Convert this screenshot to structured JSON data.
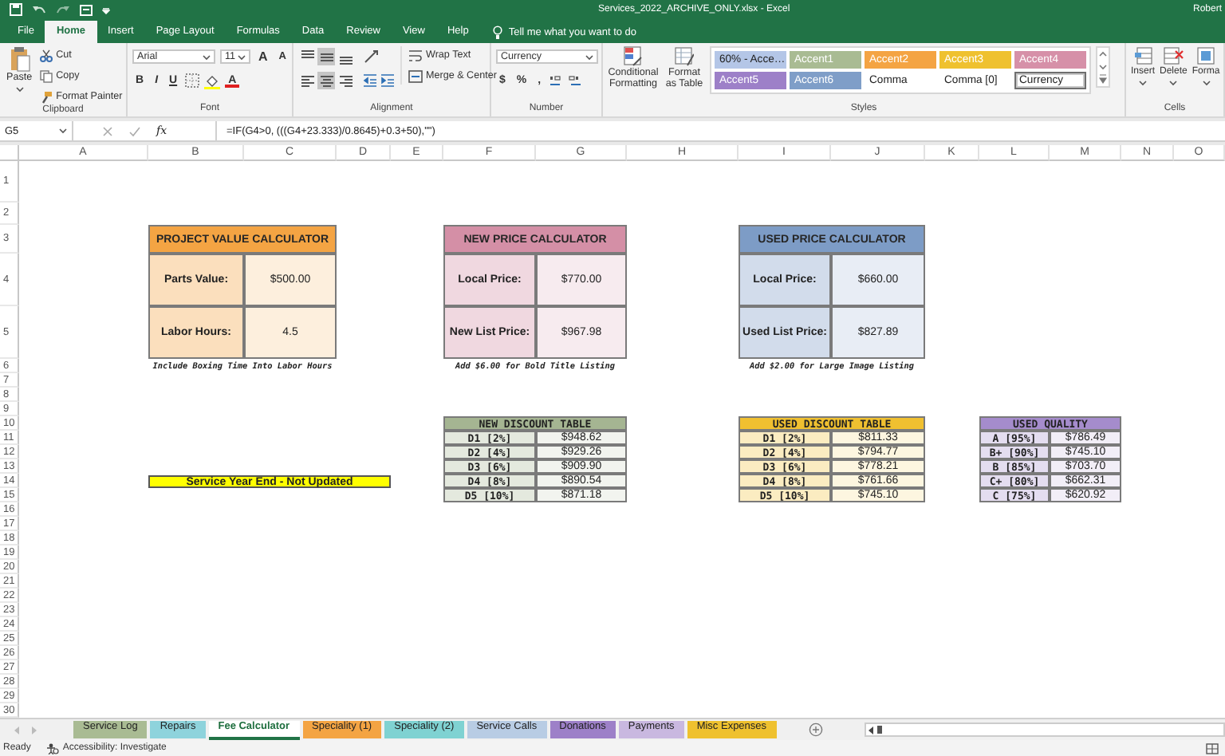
{
  "title_bar": {
    "title": "Services_2022_ARCHIVE_ONLY.xlsx - Excel",
    "user": "Robert"
  },
  "ribbon_tabs": [
    {
      "label": "File",
      "selected": false
    },
    {
      "label": "Home",
      "selected": true
    },
    {
      "label": "Insert",
      "selected": false
    },
    {
      "label": "Page Layout",
      "selected": false
    },
    {
      "label": "Formulas",
      "selected": false
    },
    {
      "label": "Data",
      "selected": false
    },
    {
      "label": "Review",
      "selected": false
    },
    {
      "label": "View",
      "selected": false
    },
    {
      "label": "Help",
      "selected": false
    }
  ],
  "tell_me": "Tell me what you want to do",
  "clipboard": {
    "paste": "Paste",
    "cut": "Cut",
    "copy": "Copy",
    "format_painter": "Format Painter",
    "label": "Clipboard"
  },
  "font": {
    "name": "Arial",
    "size": "11",
    "grow": "A",
    "shrink": "A",
    "bold": "B",
    "italic": "I",
    "underline": "U",
    "font_color": "A",
    "label": "Font"
  },
  "alignment": {
    "buttons": [
      {
        "selected": false
      },
      {
        "selected": true
      },
      {
        "selected": false
      },
      {
        "selected": false
      },
      {
        "selected": true
      },
      {
        "selected": false
      }
    ],
    "wrap_text": "Wrap Text",
    "merge_center": "Merge & Center",
    "label": "Alignment"
  },
  "number": {
    "format": "Currency",
    "currency": "$",
    "percent": "%",
    "comma": ",",
    "label": "Number"
  },
  "styles": {
    "conditional_formatting": "Conditional Formatting",
    "format_as_table": "Format as Table",
    "label": "Styles",
    "items": [
      {
        "label": "60% - Acce…",
        "kind": "tint",
        "color": "#b4c6e7",
        "selected": false
      },
      {
        "label": "Accent1",
        "kind": "accent",
        "color": "#a9bb93",
        "selected": false
      },
      {
        "label": "Accent2",
        "kind": "accent",
        "color": "#f4a443",
        "selected": false
      },
      {
        "label": "Accent3",
        "kind": "accent",
        "color": "#efc12f",
        "selected": false
      },
      {
        "label": "Accent4",
        "kind": "accent",
        "color": "#d690a8",
        "selected": false
      },
      {
        "label": "Accent5",
        "kind": "accent",
        "color": "#9d80c8",
        "selected": false
      },
      {
        "label": "Accent6",
        "kind": "accent",
        "color": "#7f9ec8",
        "selected": false
      },
      {
        "label": "Comma",
        "kind": "plain",
        "color": "#ffffff",
        "selected": false
      },
      {
        "label": "Comma [0]",
        "kind": "plain",
        "color": "#ffffff",
        "selected": false
      },
      {
        "label": "Currency",
        "kind": "plain",
        "color": "#ffffff",
        "selected": true
      }
    ]
  },
  "cells": {
    "insert": "Insert",
    "delete": "Delete",
    "format": "Forma",
    "label": "Cells"
  },
  "formula_bar": {
    "name_box": "G5",
    "function_label": "fx",
    "formula": "=IF(G4>0, (((G4+23.333)/0.8645)+0.3+50),\"\")"
  },
  "columns": [
    "A",
    "B",
    "C",
    "D",
    "E",
    "F",
    "G",
    "H",
    "I",
    "J",
    "K",
    "L",
    "M",
    "N",
    "O"
  ],
  "rows": [
    "1",
    "2",
    "3",
    "4",
    "5",
    "6",
    "7",
    "8",
    "9",
    "10",
    "11",
    "12",
    "13",
    "14",
    "15",
    "16",
    "17",
    "18",
    "19",
    "20",
    "21",
    "22",
    "23",
    "24",
    "25",
    "26",
    "27",
    "28",
    "29",
    "30"
  ],
  "calculators": [
    {
      "title": "PROJECT VALUE CALCULATOR",
      "color": "#f4a443",
      "rows": [
        {
          "label": "Parts Value:",
          "value": "$500.00"
        },
        {
          "label": "Labor Hours:",
          "value": "4.5"
        }
      ],
      "note": "Include Boxing Time Into Labor Hours"
    },
    {
      "title": "NEW PRICE CALCULATOR",
      "color": "#d48fa6",
      "rows": [
        {
          "label": "Local Price:",
          "value": "$770.00"
        },
        {
          "label": "New List Price:",
          "value": "$967.98"
        }
      ],
      "note": "Add $6.00 for Bold Title Listing"
    },
    {
      "title": "USED PRICE CALCULATOR",
      "color": "#7d9cc6",
      "rows": [
        {
          "label": "Local Price:",
          "value": "$660.00"
        },
        {
          "label": "Used List Price:",
          "value": "$827.89"
        }
      ],
      "note": "Add $2.00 for Large Image Listing"
    }
  ],
  "banner": {
    "text": "Service Year End - Not Updated"
  },
  "discount_tables": [
    {
      "title": "NEW DISCOUNT TABLE",
      "color": "#a5b592",
      "rows": [
        {
          "label": "D1 [2%]",
          "value": "$948.62"
        },
        {
          "label": "D2 [4%]",
          "value": "$929.26"
        },
        {
          "label": "D3 [6%]",
          "value": "$909.90"
        },
        {
          "label": "D4 [8%]",
          "value": "$890.54"
        },
        {
          "label": "D5 [10%]",
          "value": "$871.18"
        }
      ]
    },
    {
      "title": "USED DISCOUNT TABLE",
      "color": "#f0c030",
      "rows": [
        {
          "label": "D1 [2%]",
          "value": "$811.33"
        },
        {
          "label": "D2 [4%]",
          "value": "$794.77"
        },
        {
          "label": "D3 [6%]",
          "value": "$778.21"
        },
        {
          "label": "D4 [8%]",
          "value": "$761.66"
        },
        {
          "label": "D5 [10%]",
          "value": "$745.10"
        }
      ]
    },
    {
      "title": "USED QUALITY",
      "color": "#a58ccc",
      "rows": [
        {
          "label": "A [95%]",
          "value": "$786.49"
        },
        {
          "label": "B+ [90%]",
          "value": "$745.10"
        },
        {
          "label": "B [85%]",
          "value": "$703.70"
        },
        {
          "label": "C+ [80%]",
          "value": "$662.31"
        },
        {
          "label": "C [75%]",
          "value": "$620.92"
        }
      ]
    }
  ],
  "sheet_tabs": [
    {
      "label": "Service Log",
      "color": "#a9bb93",
      "selected": false
    },
    {
      "label": "Repairs",
      "color": "#8ed3dc",
      "selected": false
    },
    {
      "label": "Fee Calculator",
      "selected": true
    },
    {
      "label": "Speciality (1)",
      "color": "#f4a443",
      "selected": false
    },
    {
      "label": "Speciality (2)",
      "color": "#7fd2d2",
      "selected": false
    },
    {
      "label": "Service Calls",
      "color": "#b8cce4",
      "selected": false
    },
    {
      "label": "Donations",
      "color": "#9d80c8",
      "selected": false
    },
    {
      "label": "Payments",
      "color": "#c9b8e0",
      "selected": false
    },
    {
      "label": "Misc Expenses",
      "color": "#efc12f",
      "selected": false
    }
  ],
  "status_bar": {
    "mode": "Ready",
    "accessibility": "Accessibility: Investigate"
  }
}
